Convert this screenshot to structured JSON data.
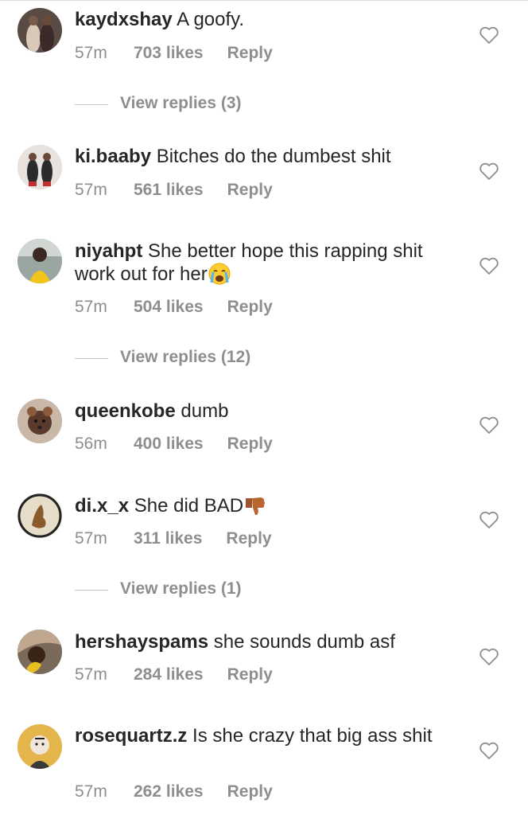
{
  "comments": [
    {
      "username": "kaydxshay",
      "text": "A goofy.",
      "time": "57m",
      "likes": "703 likes",
      "reply": "Reply",
      "view_replies": "View replies (3)"
    },
    {
      "username": "ki.baaby",
      "text": "Bitches do the dumbest shit",
      "time": "57m",
      "likes": "561 likes",
      "reply": "Reply"
    },
    {
      "username": "niyahpt",
      "text": "She better hope this rapping shit work out for her",
      "emoji": "crying-face-emoji",
      "time": "57m",
      "likes": "504 likes",
      "reply": "Reply",
      "view_replies": "View replies (12)"
    },
    {
      "username": "queenkobe",
      "text": "dumb",
      "time": "56m",
      "likes": "400 likes",
      "reply": "Reply"
    },
    {
      "username": "di.x_x",
      "text": "She did BAD",
      "emoji": "thumbs-down-emoji",
      "time": "57m",
      "likes": "311 likes",
      "reply": "Reply",
      "view_replies": "View replies (1)"
    },
    {
      "username": "hershayspams",
      "text": "she sounds dumb asf",
      "time": "57m",
      "likes": "284 likes",
      "reply": "Reply"
    },
    {
      "username": "rosequartz.z",
      "text": "Is she crazy that big ass shit",
      "time": "57m",
      "likes": "262 likes",
      "reply": "Reply"
    }
  ],
  "icons": {
    "like": "heart-outline-icon"
  },
  "colors": {
    "text": "#262626",
    "meta": "#8e8e8e",
    "divider": "#c7c7c7"
  }
}
